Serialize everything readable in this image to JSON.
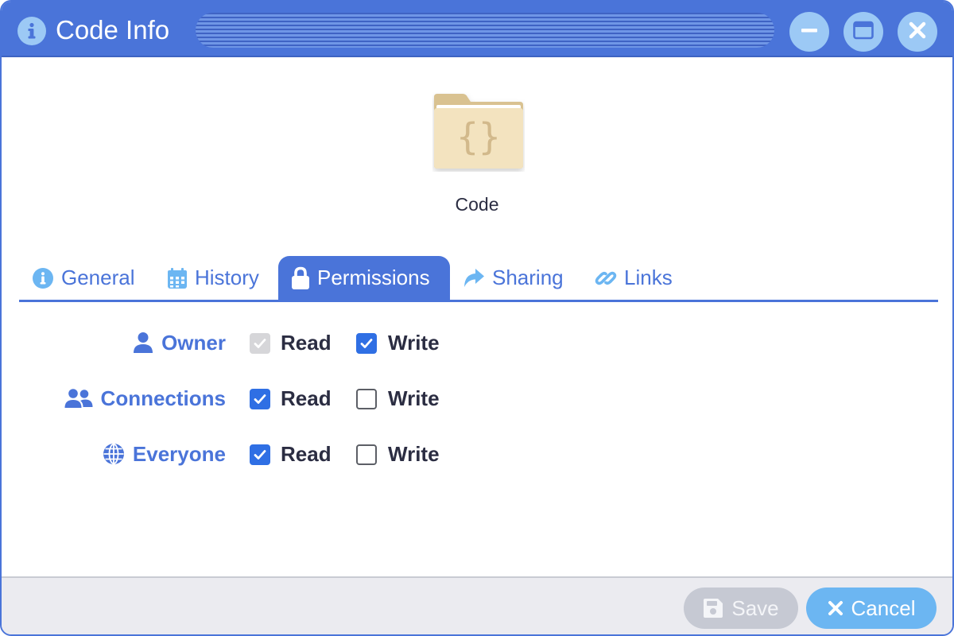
{
  "window": {
    "title": "Code Info",
    "title_icon": "info-circle-icon",
    "controls": {
      "minimize": "minimize-icon",
      "maximize": "maximize-icon",
      "close": "close-icon"
    },
    "accent_color": "#4a74d9",
    "control_color": "#9cc9f5"
  },
  "item": {
    "name": "Code",
    "icon": "code-folder-icon",
    "folder_color": "#f2e0b8"
  },
  "tabs": [
    {
      "label": "General",
      "icon": "info-circle-icon",
      "active": false
    },
    {
      "label": "History",
      "icon": "calendar-icon",
      "active": false
    },
    {
      "label": "Permissions",
      "icon": "lock-icon",
      "active": true
    },
    {
      "label": "Sharing",
      "icon": "share-arrow-icon",
      "active": false
    },
    {
      "label": "Links",
      "icon": "link-icon",
      "active": false
    }
  ],
  "permissions": {
    "read_label": "Read",
    "write_label": "Write",
    "rows": [
      {
        "role": "Owner",
        "icon": "user-icon",
        "read": true,
        "read_disabled": true,
        "write": true
      },
      {
        "role": "Connections",
        "icon": "users-icon",
        "read": true,
        "read_disabled": false,
        "write": false
      },
      {
        "role": "Everyone",
        "icon": "globe-icon",
        "read": true,
        "read_disabled": false,
        "write": false
      }
    ],
    "checked_color": "#2f6fe4"
  },
  "footer": {
    "save_label": "Save",
    "save_enabled": false,
    "save_icon": "floppy-disk-icon",
    "cancel_label": "Cancel",
    "cancel_icon": "close-icon",
    "cancel_color": "#6cb6f2"
  }
}
